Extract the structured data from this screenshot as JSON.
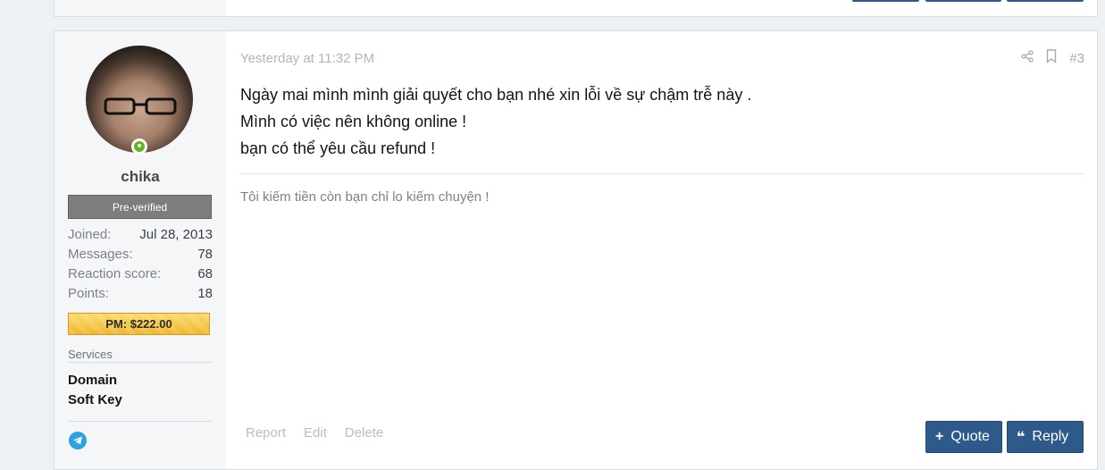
{
  "post": {
    "username": "chika",
    "badge": "Pre-verified",
    "stats": [
      {
        "label": "Joined:",
        "value": "Jul 28, 2013"
      },
      {
        "label": "Messages:",
        "value": "78"
      },
      {
        "label": "Reaction score:",
        "value": "68"
      },
      {
        "label": "Points:",
        "value": "18"
      }
    ],
    "pm_label": "PM: $222.00",
    "services_title": "Services",
    "services": [
      "Domain",
      "Soft Key"
    ],
    "timestamp": "Yesterday at 11:32 PM",
    "post_number": "#3",
    "message_lines": [
      "Ngày mai mình mình giải quyết cho bạn nhé xin lỗi về sự chậm trễ này .",
      "Mình có việc nên không online !",
      "bạn có thể yêu cầu refund !"
    ],
    "signature": "Tôi kiếm tiền còn bạn chỉ lo kiếm chuyện !",
    "footer_links": [
      "Report",
      "Edit",
      "Delete"
    ],
    "quote_label": "Quote",
    "reply_label": "Reply"
  },
  "colors": {
    "accent": "#2d5a8a",
    "online": "#63b520",
    "badge_bg": "#7d7d7d",
    "pm_gold": "#f0b72b",
    "telegram": "#2aa3e0"
  },
  "icons": [
    "share-icon",
    "bookmark-icon",
    "online-status-icon",
    "telegram-icon",
    "plus-icon",
    "quote-marks-icon"
  ]
}
